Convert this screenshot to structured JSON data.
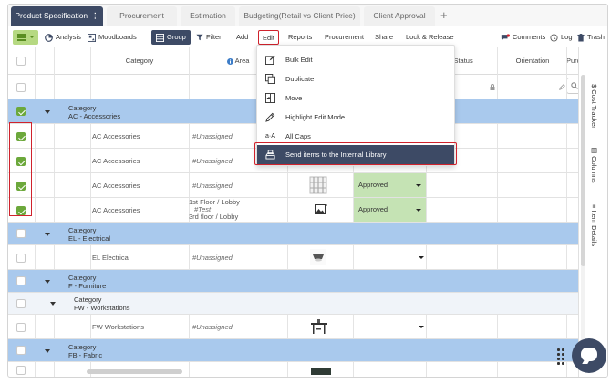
{
  "tabs": [
    {
      "label": "Product Specification",
      "more": "⋮"
    },
    {
      "label": "Procurement"
    },
    {
      "label": "Estimation"
    },
    {
      "label": "Budgeting(Retail vs Client Price)"
    },
    {
      "label": "Client Approval"
    }
  ],
  "tab_add": "+",
  "toolbar": {
    "analysis": "Analysis",
    "moodboards": "Moodboards",
    "group": "Group",
    "filter": "Filter",
    "add": "Add",
    "edit": "Edit",
    "reports": "Reports",
    "procurement": "Procurement",
    "share": "Share",
    "lock_release": "Lock & Release",
    "comments": "Comments",
    "log": "Log",
    "trash": "Trash"
  },
  "columns": {
    "category": "Category",
    "area": "Area",
    "status": "/ Status",
    "orientation": "Orientation",
    "purchase": "Purc"
  },
  "groups": {
    "ac": {
      "label": "Category",
      "value": "AC - Accessories"
    },
    "el": {
      "label": "Category",
      "value": "EL - Electrical"
    },
    "f": {
      "label": "Category",
      "value": "F - Furniture"
    },
    "fw": {
      "label": "Category",
      "value": "FW - Workstations"
    },
    "fb": {
      "label": "Category",
      "value": "FB - Fabric"
    }
  },
  "rows": [
    {
      "category": "AC Accessories",
      "area": "#Unassigned",
      "status": ""
    },
    {
      "category": "AC Accessories",
      "area": "#Unassigned",
      "status": ""
    },
    {
      "category": "AC Accessories",
      "area": "#Unassigned",
      "status": "Approved"
    },
    {
      "category": "AC Accessories",
      "area_line1": "1st Floor / Lobby",
      "area_line2": "#Test",
      "area_line3": "3rd floor / Lobby",
      "status": "Approved"
    },
    {
      "category": "EL Electrical",
      "area": "#Unassigned",
      "status": ""
    },
    {
      "category": "FW Workstations",
      "area": "#Unassigned",
      "status": ""
    }
  ],
  "dropdown": {
    "items": [
      {
        "label": "Bulk Edit",
        "icon": "pencil-square-icon"
      },
      {
        "label": "Duplicate",
        "icon": "duplicate-icon"
      },
      {
        "label": "Move",
        "icon": "move-icon"
      },
      {
        "label": "Highlight Edit Mode",
        "icon": "highlight-pen-icon"
      },
      {
        "label": "All Caps",
        "icon": "all-caps-icon"
      },
      {
        "label": "Send items to the Internal Library",
        "icon": "library-send-icon"
      }
    ]
  },
  "side_panel": {
    "cost_tracker": "Cost Tracker",
    "columns": "Columns",
    "item_details": "Item Details"
  },
  "colors": {
    "accent_dark": "#3d4a65",
    "category_blue": "#a9c9ed",
    "approved_green": "#c5e3b4",
    "check_green": "#6ca83b",
    "highlight_red": "#d0222c"
  }
}
